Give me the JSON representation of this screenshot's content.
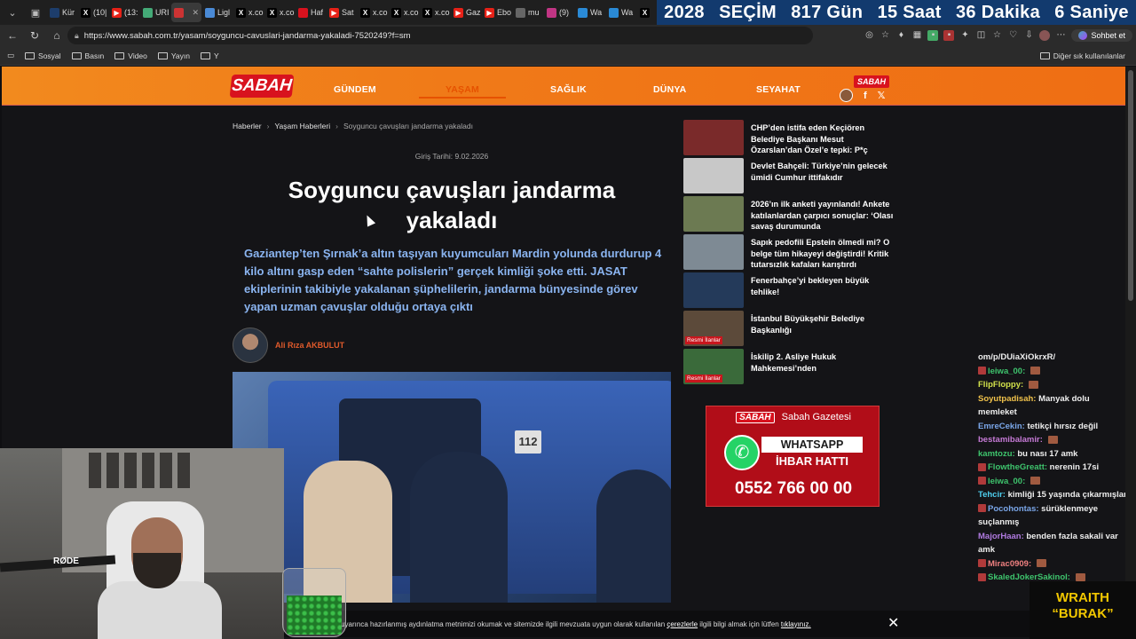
{
  "tabs": [
    {
      "label": "Kür",
      "icon": "tab-icon",
      "color": "#1d3d6b"
    },
    {
      "label": "(10|",
      "icon": "x-icon",
      "color": "#000000"
    },
    {
      "label": "(13:",
      "icon": "youtube-icon",
      "color": "#e62117"
    },
    {
      "label": "URI",
      "icon": "page-icon",
      "color": "#4a7"
    },
    {
      "label": "",
      "icon": "flag-icon",
      "color": "#c33"
    },
    {
      "label": "Ligl",
      "icon": "pen-icon",
      "color": "#4a8ad6"
    },
    {
      "label": "x.co",
      "icon": "x-icon",
      "color": "#000000"
    },
    {
      "label": "x.co",
      "icon": "x-icon",
      "color": "#000000"
    },
    {
      "label": "Haf",
      "icon": "news-icon",
      "color": "#d8121e"
    },
    {
      "label": "Sat",
      "icon": "youtube-icon",
      "color": "#e62117"
    },
    {
      "label": "x.co",
      "icon": "x-icon",
      "color": "#000000"
    },
    {
      "label": "x.co",
      "icon": "x-icon",
      "color": "#000000"
    },
    {
      "label": "x.co",
      "icon": "x-icon",
      "color": "#000000"
    },
    {
      "label": "Gaz",
      "icon": "youtube-icon",
      "color": "#e62117"
    },
    {
      "label": "Ebo",
      "icon": "youtube-icon",
      "color": "#e62117"
    },
    {
      "label": "mu",
      "icon": "globe-icon",
      "color": "#666"
    },
    {
      "label": "(9)",
      "icon": "instagram-icon",
      "color": "#c13584"
    },
    {
      "label": "Wa",
      "icon": "wa-icon",
      "color": "#2a8ad6"
    },
    {
      "label": "Wa",
      "icon": "wa-icon",
      "color": "#2a8ad6"
    },
    {
      "label": "",
      "icon": "x-icon",
      "color": "#000000"
    }
  ],
  "countdown": {
    "year": "2028",
    "word": "SEÇİM",
    "days": "817 Gün",
    "hours": "15 Saat",
    "minutes": "36 Dakika",
    "seconds": "6 Saniye"
  },
  "address": {
    "url": "https://www.sabah.com.tr/yasam/soyguncu-cavuslari-jandarma-yakaladi-7520249?f=sm",
    "chat_label": "Sohbet et"
  },
  "bookmarks": [
    {
      "label": "Sosyal"
    },
    {
      "label": "Basın"
    },
    {
      "label": "Video"
    },
    {
      "label": "Yayın"
    },
    {
      "label": "Y"
    }
  ],
  "bookmarks_right": "Diğer sık kullanılanlar",
  "site": {
    "logo": "SABAH",
    "mini_logo": "SABAH",
    "nav": [
      "GÜNDEM",
      "YAŞAM",
      "SAĞLIK",
      "DÜNYA",
      "SEYAHAT"
    ],
    "nav_active": "YAŞAM",
    "accent": "#f07a18"
  },
  "breadcrumb": {
    "items": [
      "Haberler",
      "Yaşam Haberleri",
      "Soyguncu çavuşları jandarma yakaladı"
    ]
  },
  "article": {
    "date": "Giriş Tarihi: 9.02.2026",
    "title": "Soyguncu çavuşları jandarma yakaladı",
    "lead": "Gaziantep’ten Şırnak’a altın taşıyan kuyumcuları Mardin yolunda durdurup 4 kilo altını gasp eden “sahte polislerin” gerçek kimliği şoke etti. JASAT ekiplerinin takibiyle yakalanan şüphelilerin, jandarma bünyesinde görev yapan uzman çavuşlar olduğu ortaya çıktı",
    "author": "Ali Rıza AKBULUT",
    "photo_badge": "112"
  },
  "sidebar_news": [
    {
      "text": "CHP’den istifa eden Keçiören Belediye Başkanı Mesut Özarslan’dan Özel’e tepki: P*ç",
      "color": "#7a2a2a",
      "tag": ""
    },
    {
      "text": "Devlet Bahçeli: Türkiye’nin gelecek ümidi Cumhur ittifakıdır",
      "color": "#c8c8c8",
      "tag": ""
    },
    {
      "text": "2026’ın ilk anketi yayınlandı! Ankete katılanlardan çarpıcı sonuçlar: ‘Olası savaş durumunda",
      "color": "#6c7a52",
      "tag": ""
    },
    {
      "text": "Sapık pedofili Epstein ölmedi mi? O belge tüm hikayeyi değiştirdi! Kritik tutarsızlık kafaları karıştırdı",
      "color": "#7e8a94",
      "tag": ""
    },
    {
      "text": "Fenerbahçe’yi bekleyen büyük tehlike!",
      "color": "#243a5a",
      "tag": ""
    },
    {
      "text": "İstanbul Büyükşehir Belediye Başkanlığı",
      "color": "#5c4a3a",
      "tag": "Resmi İlanlar"
    },
    {
      "text": "İskilip 2. Asliye Hukuk Mahkemesi’nden",
      "color": "#3a6a3a",
      "tag": "Resmi İlanlar"
    }
  ],
  "ad": {
    "brand": "SABAH",
    "brand_text": "Sabah Gazetesi",
    "whatsapp": "WHATSAPP",
    "line": "İHBAR HATTI",
    "phone": "0552 766 00 00"
  },
  "chat": [
    {
      "user": "",
      "msg": "om/p/DUiaXiOkrxR/",
      "color": "#eeeeee",
      "badge": false
    },
    {
      "user": "leiwa_00:",
      "msg": "",
      "color": "#3ec46d",
      "badge": true
    },
    {
      "user": "FlipFloppy:",
      "msg": "",
      "color": "#d2e14b",
      "badge": false
    },
    {
      "user": "Soyutpadisah:",
      "msg": "Manyak dolu memleket",
      "color": "#f0c24b",
      "badge": false
    },
    {
      "user": "EmreCekin:",
      "msg": "tetikçi hırsız değil",
      "color": "#7aa6e8",
      "badge": false
    },
    {
      "user": "bestamibalamir:",
      "msg": "",
      "color": "#c67ad6",
      "badge": false
    },
    {
      "user": "kamtozu:",
      "msg": "bu nası 17 amk",
      "color": "#3ec46d",
      "badge": false
    },
    {
      "user": "FlowtheGreatt:",
      "msg": "nerenin 17si",
      "color": "#3ec46d",
      "badge": true
    },
    {
      "user": "leiwa_00:",
      "msg": "",
      "color": "#3ec46d",
      "badge": true
    },
    {
      "user": "Tehcir:",
      "msg": "kimliği 15 yaşında çıkarmışlar",
      "color": "#4fd0f0",
      "badge": false
    },
    {
      "user": "Pocohontas:",
      "msg": "sürüklenmeye suçlanmış",
      "color": "#7aa6e8",
      "badge": true
    },
    {
      "user": "MajorHaan:",
      "msg": "benden fazla sakali var amk",
      "color": "#b07ae0",
      "badge": false
    },
    {
      "user": "Mirac0909:",
      "msg": "",
      "color": "#f08080",
      "badge": true
    },
    {
      "user": "SkaledJokerSakinol:",
      "msg": "",
      "color": "#3ec46d",
      "badge": true
    }
  ],
  "cookie": {
    "prefix": "Kanunu uyarınca hazırlanmış aydınlatma metnimizi okumak ve sitemizde ilgili mevzuata uygun olarak kullanılan",
    "link1": "çerezlerle",
    "middle": "ilgili bilgi almak için lütfen",
    "link2": "tıklayınız."
  },
  "overlay": {
    "mic_brand": "RØDE",
    "wraith_top": "WRAITH",
    "wraith_bottom": "“BURAK”"
  }
}
